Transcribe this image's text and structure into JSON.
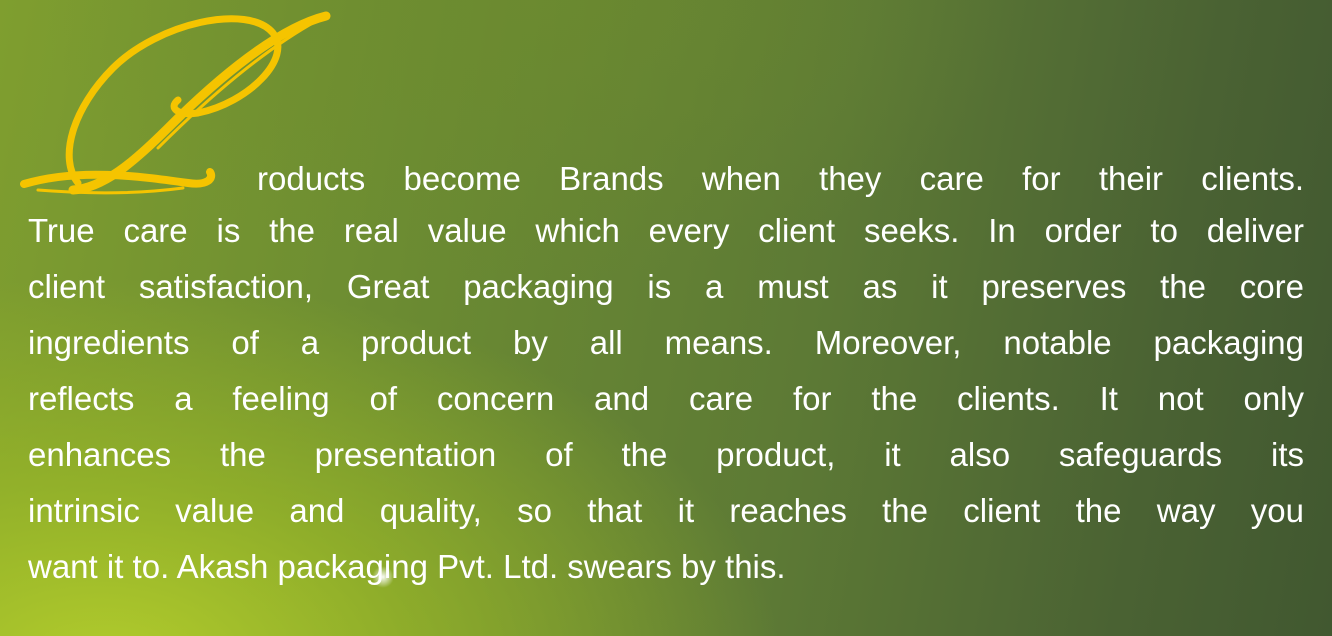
{
  "drop_cap": {
    "letter": "P",
    "color": "#f5c400"
  },
  "paragraph": {
    "lines": [
      "roducts become Brands when they care for their clients.",
      "True care is the real value which every client seeks. In order to deliver",
      "client satisfaction, Great packaging is a must as it preserves the core",
      "ingredients of a product by all means. Moreover, notable packaging",
      "reflects a feeling of concern and care for the clients. It not only",
      "enhances the presentation of the product, it also safeguards its",
      "intrinsic value and quality, so that it reaches the client the way you",
      "want it to. Akash packaging Pvt. Ltd. swears by this."
    ]
  },
  "colors": {
    "text": "#ffffff",
    "background_light": "#b2cc2c",
    "background_dark": "#415830"
  }
}
